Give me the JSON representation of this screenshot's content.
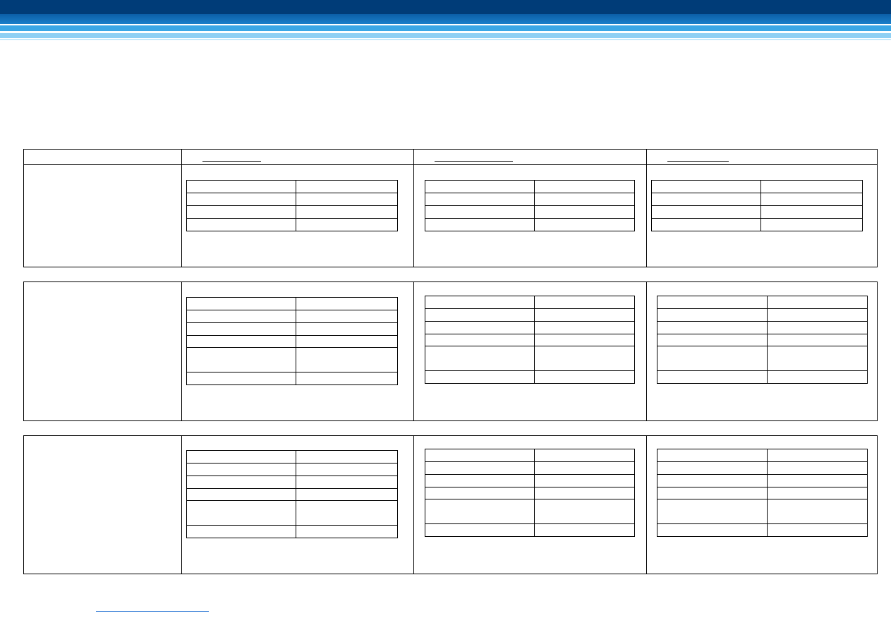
{
  "colors": {
    "header_dark": "#003c78",
    "header_mid": "#0b6db8",
    "header_light": "#4fb6ee",
    "header_pale": "#a8dcf7",
    "link": "#1f6fd1",
    "border": "#000000"
  },
  "header": {
    "title": ""
  },
  "comparison": {
    "columns": [
      {
        "label": ""
      },
      {
        "label": ""
      },
      {
        "label": ""
      }
    ],
    "groups": [
      {
        "label": ""
      },
      {
        "label": ""
      },
      {
        "label": ""
      }
    ]
  },
  "footer": {
    "link_text": ""
  }
}
